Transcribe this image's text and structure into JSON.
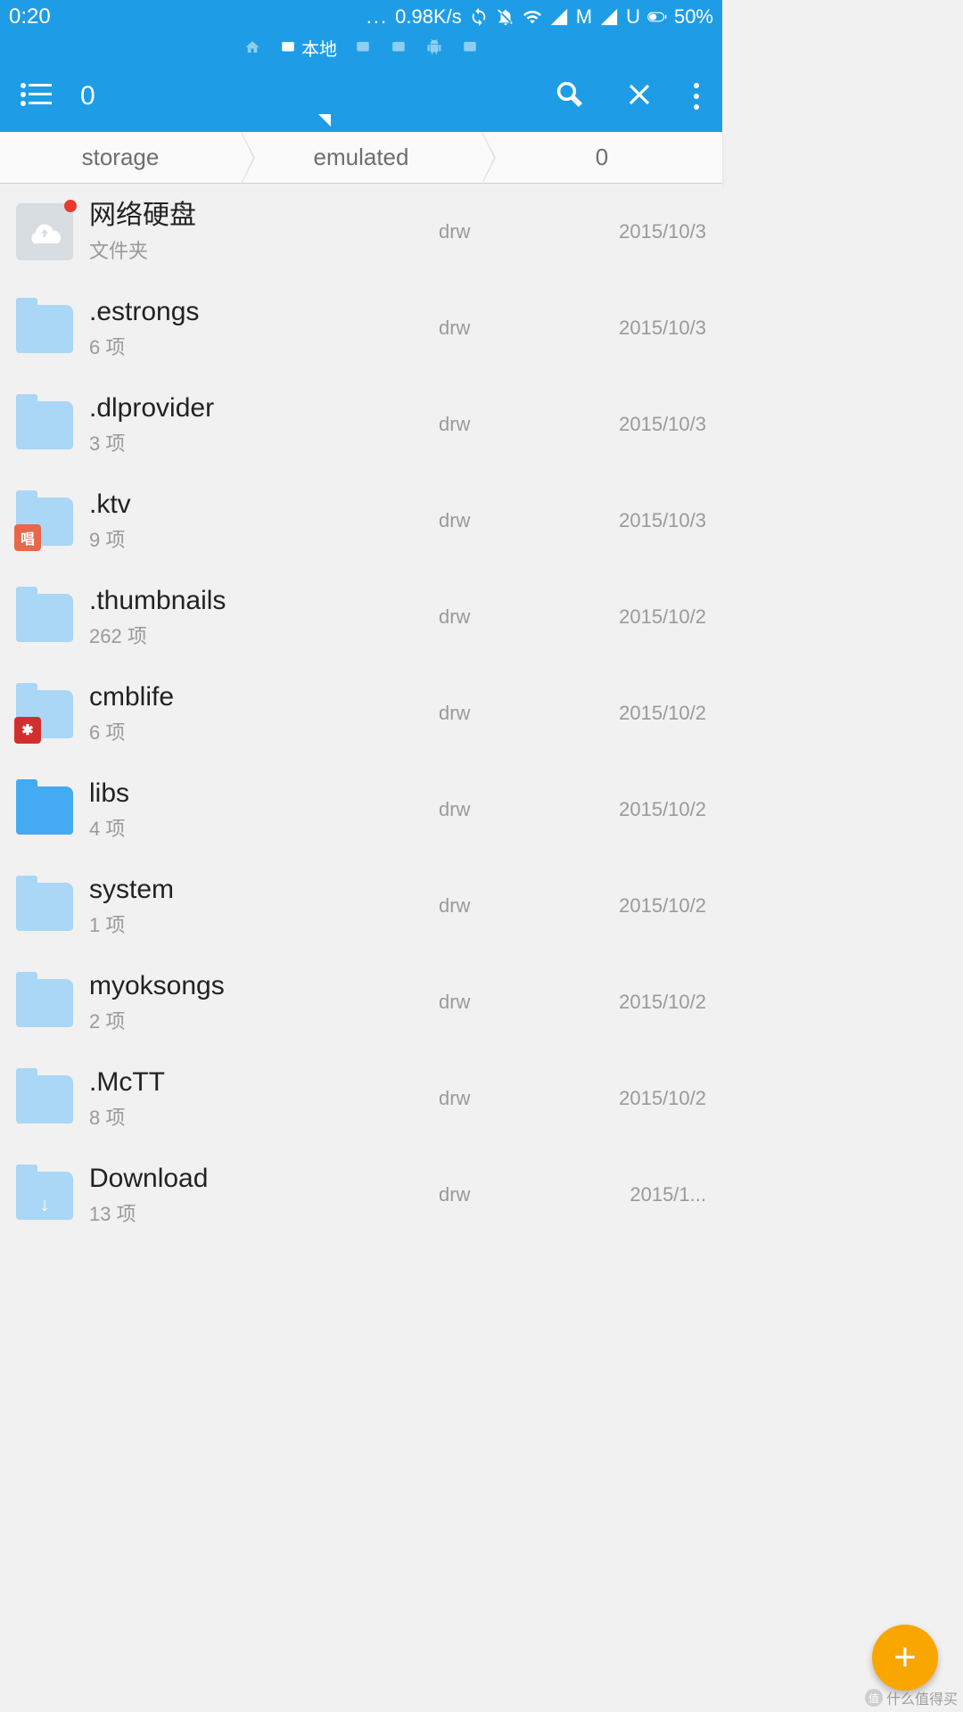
{
  "status": {
    "time": "0:20",
    "net_speed": "0.98K/s",
    "sim1_label": "M",
    "sim2_label": "U",
    "battery_pct": "50%"
  },
  "top_tabs": {
    "active_label": "本地"
  },
  "toolbar": {
    "window_count": "0"
  },
  "breadcrumb": [
    "storage",
    "emulated",
    "0"
  ],
  "files": [
    {
      "name": "网络硬盘",
      "sub": "文件夹",
      "perm": "drw",
      "date": "2015/10/3",
      "icon": "cloud",
      "badge": ""
    },
    {
      "name": ".estrongs",
      "sub": "6 项",
      "perm": "drw",
      "date": "2015/10/3",
      "icon": "folder-light",
      "badge": ""
    },
    {
      "name": ".dlprovider",
      "sub": "3 项",
      "perm": "drw",
      "date": "2015/10/3",
      "icon": "folder-light",
      "badge": ""
    },
    {
      "name": ".ktv",
      "sub": "9 项",
      "perm": "drw",
      "date": "2015/10/3",
      "icon": "folder-light",
      "badge": "唱",
      "badge_color": "#e8674a"
    },
    {
      "name": ".thumbnails",
      "sub": "262 项",
      "perm": "drw",
      "date": "2015/10/2",
      "icon": "folder-light",
      "badge": ""
    },
    {
      "name": "cmblife",
      "sub": "6 项",
      "perm": "drw",
      "date": "2015/10/2",
      "icon": "folder-light",
      "badge": "✱",
      "badge_color": "#d12f2f"
    },
    {
      "name": "libs",
      "sub": "4 项",
      "perm": "drw",
      "date": "2015/10/2",
      "icon": "folder-solid",
      "badge": ""
    },
    {
      "name": "system",
      "sub": "1 项",
      "perm": "drw",
      "date": "2015/10/2",
      "icon": "folder-light",
      "badge": ""
    },
    {
      "name": "myoksongs",
      "sub": "2 项",
      "perm": "drw",
      "date": "2015/10/2",
      "icon": "folder-light",
      "badge": ""
    },
    {
      "name": ".McTT",
      "sub": "8 项",
      "perm": "drw",
      "date": "2015/10/2",
      "icon": "folder-light",
      "badge": ""
    },
    {
      "name": "Download",
      "sub": "13 项",
      "perm": "drw",
      "date": "2015/1...",
      "icon": "folder-dl",
      "badge": ""
    }
  ],
  "watermark": "什么值得买"
}
